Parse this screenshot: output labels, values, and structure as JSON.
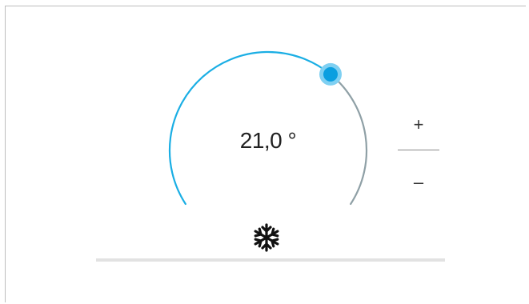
{
  "thermostat": {
    "temperature_display": "21,0 °",
    "mode_icon": "snowflake-icon",
    "mode": "cooling",
    "setpoint_fraction": 0.66
  },
  "controls": {
    "plus_label": "+",
    "minus_label": "–"
  },
  "colors": {
    "active_arc": "#1aaee4",
    "inactive_arc": "#8fa0a6",
    "knob": "#0a9fe0",
    "knob_halo": "#7fd0f2",
    "baseline": "#e2e2e2"
  }
}
